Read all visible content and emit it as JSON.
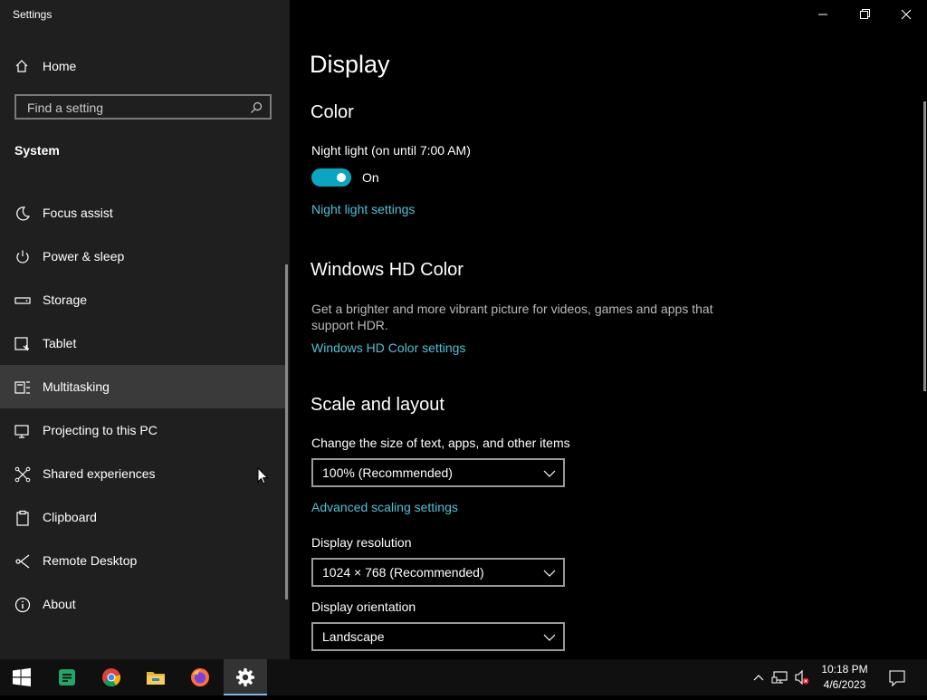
{
  "window": {
    "title": "Settings"
  },
  "sidebar": {
    "home": {
      "label": "Home",
      "icon": "home-icon"
    },
    "search": {
      "placeholder": "Find a setting",
      "icon": "search-icon"
    },
    "section": "System",
    "items": [
      {
        "label": "Focus assist",
        "icon": "moon-icon",
        "selected": false
      },
      {
        "label": "Power & sleep",
        "icon": "power-icon",
        "selected": false
      },
      {
        "label": "Storage",
        "icon": "storage-icon",
        "selected": false
      },
      {
        "label": "Tablet",
        "icon": "tablet-icon",
        "selected": false
      },
      {
        "label": "Multitasking",
        "icon": "multitasking-icon",
        "selected": true
      },
      {
        "label": "Projecting to this PC",
        "icon": "projecting-icon",
        "selected": false
      },
      {
        "label": "Shared experiences",
        "icon": "shared-experiences-icon",
        "selected": false
      },
      {
        "label": "Clipboard",
        "icon": "clipboard-icon",
        "selected": false
      },
      {
        "label": "Remote Desktop",
        "icon": "remote-desktop-icon",
        "selected": false
      },
      {
        "label": "About",
        "icon": "info-icon",
        "selected": false
      }
    ]
  },
  "main": {
    "title": "Display",
    "color": {
      "heading": "Color",
      "night_light_label": "Night light (on until 7:00 AM)",
      "toggle_state": "On",
      "night_light_link": "Night light settings"
    },
    "hd_color": {
      "heading": "Windows HD Color",
      "description": "Get a brighter and more vibrant picture for videos, games and apps that support HDR.",
      "link": "Windows HD Color settings"
    },
    "scale": {
      "heading": "Scale and layout",
      "size_label": "Change the size of text, apps, and other items",
      "size_value": "100% (Recommended)",
      "advanced_link": "Advanced scaling settings",
      "resolution_label": "Display resolution",
      "resolution_value": "1024 × 768 (Recommended)",
      "orientation_label": "Display orientation",
      "orientation_value": "Landscape"
    }
  },
  "taskbar": {
    "apps": [
      "start-icon",
      "sheets-icon",
      "chrome-icon",
      "file-explorer-icon",
      "firefox-icon",
      "settings-icon"
    ],
    "active_app": "settings-icon",
    "clock": {
      "time": "10:18 PM",
      "date": "4/6/2023"
    }
  },
  "colors": {
    "accent": "#0aa6c1",
    "link": "#4cc2d6",
    "sidebar_bg": "#1f1f1f",
    "selected_bg": "#3a3a3a"
  }
}
